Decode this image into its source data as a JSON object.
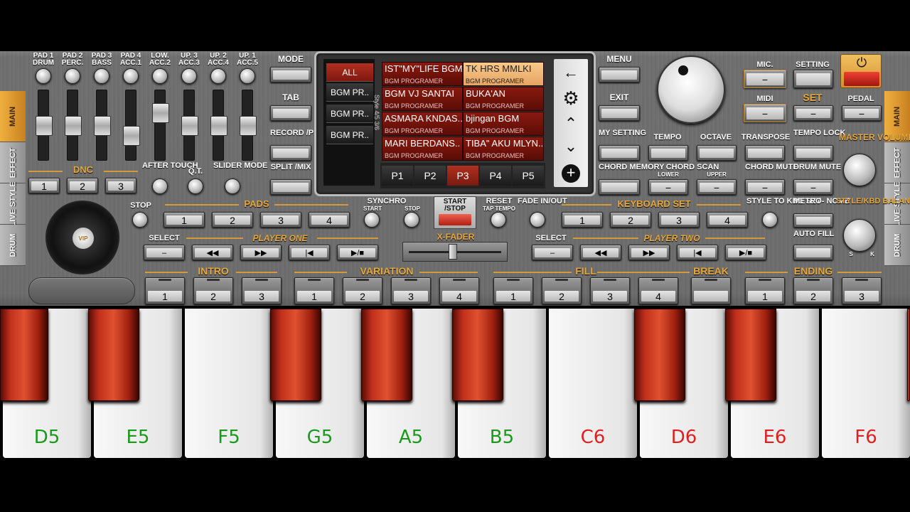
{
  "side_tabs_left": [
    "MAIN",
    "EFFECT",
    "LIVE STYLE",
    "DRUM"
  ],
  "side_tabs_right": [
    "MAIN",
    "EFFECT",
    "LIVE STYLE",
    "DRUM"
  ],
  "mixer": {
    "channels": [
      "PAD 1 DRUM",
      "PAD 2 PERC.",
      "PAD 3 BASS",
      "PAD 4 ACC.1",
      "LOW. ACC.2",
      "UP. 3 ACC.3",
      "UP. 2 ACC.4",
      "UP. 1 ACC.5"
    ],
    "levels": [
      0.5,
      0.5,
      0.5,
      0.3,
      0.75,
      0.5,
      0.5,
      0.5
    ]
  },
  "dnc": {
    "label": "DNC",
    "buttons": [
      "1",
      "2",
      "3"
    ]
  },
  "knob_labels": {
    "after_touch": "AFTER TOUCH",
    "qt": "Q.T.",
    "slider_mode": "SLIDER MODE"
  },
  "vip_label": "VIP",
  "left_menu": {
    "mode": "MODE",
    "tab": "TAB",
    "record_play": "RECORD /PLAY",
    "split_mix": "SPLIT /MIX"
  },
  "screen": {
    "categories": [
      "ALL",
      "BGM PR..",
      "BGM PR..",
      "BGM PR.."
    ],
    "side_text": "Style 4/5 3/6",
    "styles": [
      {
        "name": "IST\"MY\"LIFE BGM",
        "author": "BGM PROGRAMER"
      },
      {
        "name": "TK HRS MMLKI",
        "author": "BGM PROGRAMER"
      },
      {
        "name": "BGM VJ SANTAI",
        "author": "BGM PROGRAMER"
      },
      {
        "name": "BUKA'AN",
        "author": "BGM PROGRAMER"
      },
      {
        "name": "ASMARA KNDAS..",
        "author": "BGM PROGRAMER"
      },
      {
        "name": "bjingan BGM",
        "author": "BGM PROGRAMER"
      },
      {
        "name": "MARI BERDANS..",
        "author": "BGM PROGRAMER"
      },
      {
        "name": "TIBA\" AKU MLYN..",
        "author": "BGM PROGRAMER"
      }
    ],
    "pages": [
      "P1",
      "P2",
      "P3",
      "P4",
      "P5"
    ],
    "nav_icons": [
      "back-arrow-icon",
      "gear-icon",
      "chevron-up-icon",
      "chevron-down-icon",
      "plus-icon"
    ]
  },
  "right_menu": {
    "menu": "MENU",
    "exit": "EXIT",
    "my_setting": "MY SETTING",
    "chord_memory": "CHORD MEMORY"
  },
  "top_right": {
    "mic": "MIC.",
    "setting": "SETTING",
    "midi": "MIDI",
    "set": "SET",
    "pedal": "PEDAL"
  },
  "controls": {
    "tempo": "TEMPO",
    "octave": "OCTAVE",
    "transpose": "TRANSPOSE",
    "tempo_lock": "TEMPO LOCK",
    "master_volume": "MASTER VOLUME",
    "chord_scan": "CHORD SCAN",
    "lower": "LOWER",
    "upper": "UPPER",
    "chord_mute": "CHORD MUTE",
    "drum_mute": "DRUM MUTE",
    "style_to_kbd_set": "STYLE TO KBD SET",
    "metro_nome": "METRO- NOME",
    "auto_fill": "AUTO FILL",
    "style_kbd_balance": "STYLE/KBD BALANCE",
    "s": "S",
    "k": "K"
  },
  "pads": {
    "stop": "STOP",
    "label": "PADS",
    "buttons": [
      "1",
      "2",
      "3",
      "4"
    ]
  },
  "transport": {
    "synchro": "SYNCHRO",
    "start": "START",
    "stop": "STOP",
    "start_stop": "START /STOP",
    "reset": "RESET",
    "tap_tempo": "TAP TEMPO",
    "fade": "FADE IN/OUT"
  },
  "keyboard_set": {
    "label": "KEYBOARD SET",
    "buttons": [
      "1",
      "2",
      "3",
      "4"
    ]
  },
  "player_one": {
    "select": "SELECT",
    "label": "PLAYER ONE"
  },
  "player_two": {
    "select": "SELECT",
    "label": "PLAYER TWO"
  },
  "xfader": "X-FADER",
  "sections": {
    "intro": {
      "label": "INTRO",
      "buttons": [
        "1",
        "2",
        "3"
      ]
    },
    "variation": {
      "label": "VARIATION",
      "buttons": [
        "1",
        "2",
        "3",
        "4"
      ]
    },
    "fill": {
      "label": "FILL",
      "buttons": [
        "1",
        "2",
        "3",
        "4"
      ]
    },
    "break": {
      "label": "BREAK",
      "buttons": [
        ""
      ]
    },
    "ending": {
      "label": "ENDING",
      "buttons": [
        "1",
        "2",
        "3"
      ]
    }
  },
  "keys": [
    {
      "note": "D5",
      "color": "#1a9a1a"
    },
    {
      "note": "E5",
      "color": "#1a9a1a"
    },
    {
      "note": "F5",
      "color": "#1a9a1a"
    },
    {
      "note": "G5",
      "color": "#1a9a1a"
    },
    {
      "note": "A5",
      "color": "#1a9a1a"
    },
    {
      "note": "B5",
      "color": "#1a9a1a"
    },
    {
      "note": "C6",
      "color": "#e02020"
    },
    {
      "note": "D6",
      "color": "#e02020"
    },
    {
      "note": "E6",
      "color": "#e02020"
    },
    {
      "note": "F6",
      "color": "#e02020"
    }
  ]
}
